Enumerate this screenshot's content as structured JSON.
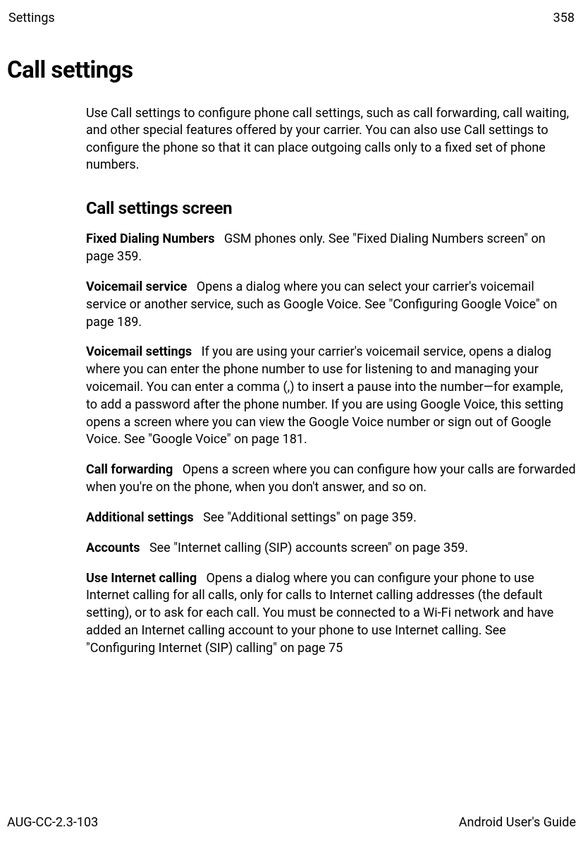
{
  "header": {
    "section": "Settings",
    "page": "358"
  },
  "title": "Call settings",
  "intro": "Use Call settings to configure phone call settings, such as call forwarding, call waiting, and other special features offered by your carrier. You can also use Call settings to configure the phone so that it can place outgoing calls only to a fixed set of phone numbers.",
  "subtitle": "Call settings screen",
  "entries": [
    {
      "label": "Fixed Dialing Numbers",
      "text": "GSM phones only. See \"Fixed Dialing Numbers screen\" on page 359."
    },
    {
      "label": "Voicemail service",
      "text": "Opens a dialog where you can select your carrier's voicemail service or another service, such as Google Voice. See \"Configuring Google Voice\" on page 189."
    },
    {
      "label": "Voicemail settings",
      "text": "If you are using your carrier's voicemail service, opens a dialog where you can enter the phone number to use for listening to and managing your voicemail. You can enter a comma (,) to insert a pause into the number—for example, to add a password after the phone number. If you are using Google Voice, this setting opens a screen where you can view the Google Voice number or sign out of Google Voice. See \"Google Voice\" on page 181."
    },
    {
      "label": "Call forwarding",
      "text": "Opens a screen where you can configure how your calls are forwarded when you're on the phone, when you don't answer, and so on."
    },
    {
      "label": "Additional settings",
      "text": "See \"Additional settings\" on page 359."
    },
    {
      "label": "Accounts",
      "text": "See \"Internet calling (SIP) accounts screen\" on page 359."
    },
    {
      "label": "Use Internet calling",
      "text": "Opens a dialog where you can configure your phone to use Internet calling for all calls, only for calls to Internet calling addresses (the default setting), or to ask for each call. You must be connected to a Wi-Fi network and have added an Internet calling account to your phone to use Internet calling. See \"Configuring Internet (SIP) calling\" on page 75"
    }
  ],
  "footer": {
    "left": "AUG-CC-2.3-103",
    "right": "Android User's Guide"
  }
}
